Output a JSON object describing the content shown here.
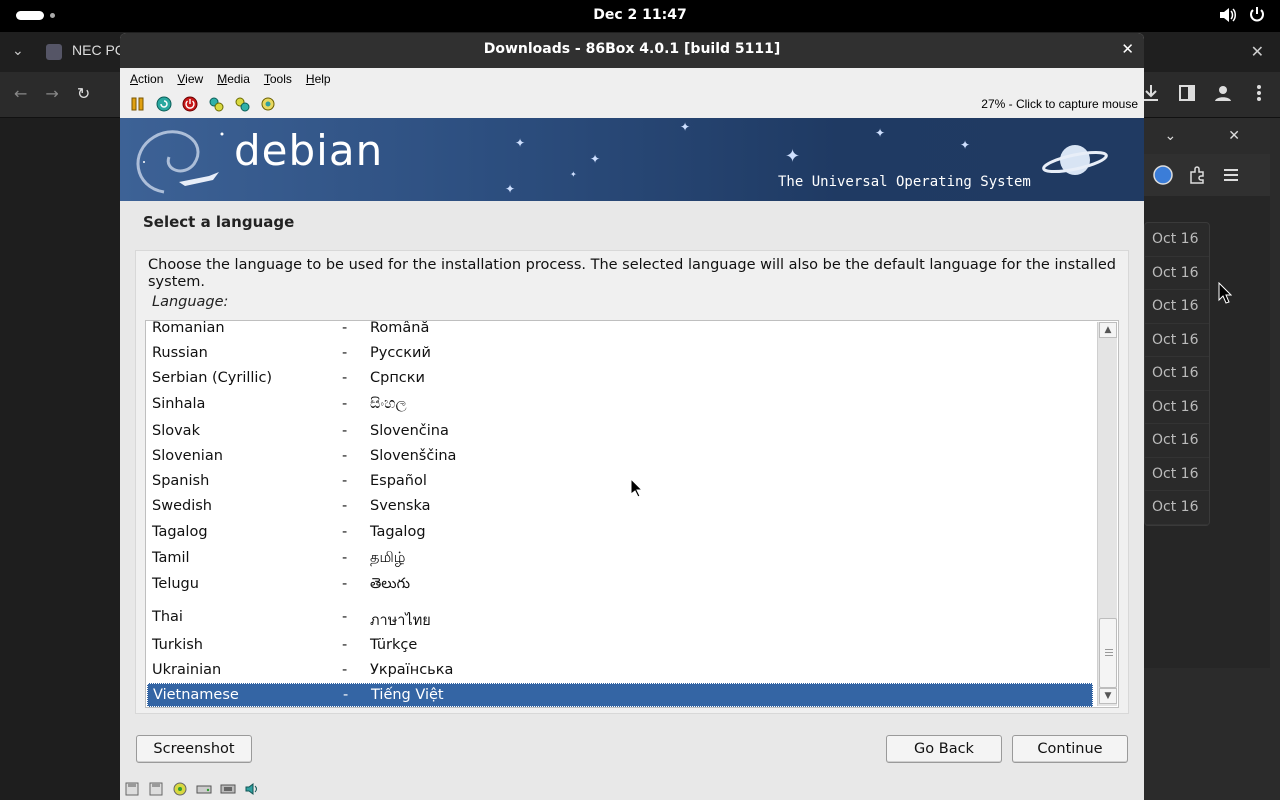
{
  "topbar": {
    "clock": "Dec 2  11:47",
    "icons": [
      "activities-pill",
      "volume-icon",
      "power-icon"
    ]
  },
  "browser": {
    "tab_title": "NEC PC",
    "download_dates": [
      "Oct 16",
      "Oct 16",
      "Oct 16",
      "Oct 16",
      "Oct 16",
      "Oct 16",
      "Oct 16",
      "Oct 16",
      "Oct 16"
    ],
    "icons": [
      "chevron-down-icon",
      "back-icon",
      "forward-icon",
      "reload-icon",
      "download-icon",
      "sidebar-icon",
      "account-icon",
      "menu-icon",
      "extensions-icon",
      "close-icon"
    ]
  },
  "vm": {
    "title": "Downloads - 86Box 4.0.1 [build 5111]",
    "menu": [
      "Action",
      "View",
      "Media",
      "Tools",
      "Help"
    ],
    "capture_text": "27% - Click to capture mouse",
    "toolbar_icons": [
      "pause-icon",
      "reset-icon",
      "power-icon",
      "ctrl-alt-del-icon",
      "ctrl-alt-esc-icon",
      "settings-icon"
    ],
    "status_icons": [
      "floppy-icon",
      "floppy-icon",
      "cdrom-icon",
      "hdd-icon",
      "network-icon",
      "sound-icon"
    ]
  },
  "installer": {
    "logo_text": "debian",
    "tagline": "The Universal Operating System",
    "heading": "Select a language",
    "description": "Choose the language to be used for the installation process. The selected language will also be the default language for the installed system.",
    "list_label": "Language:",
    "languages": [
      {
        "name": "Romanian",
        "sep": "-",
        "native": "Română"
      },
      {
        "name": "Russian",
        "sep": "-",
        "native": "Русский"
      },
      {
        "name": "Serbian (Cyrillic)",
        "sep": "-",
        "native": "Српски"
      },
      {
        "name": "Sinhala",
        "sep": "-",
        "native": "සිංහල"
      },
      {
        "name": "Slovak",
        "sep": "-",
        "native": "Slovenčina"
      },
      {
        "name": "Slovenian",
        "sep": "-",
        "native": "Slovenščina"
      },
      {
        "name": "Spanish",
        "sep": "-",
        "native": "Español"
      },
      {
        "name": "Swedish",
        "sep": "-",
        "native": "Svenska"
      },
      {
        "name": "Tagalog",
        "sep": "-",
        "native": "Tagalog"
      },
      {
        "name": "Tamil",
        "sep": "-",
        "native": "தமிழ்"
      },
      {
        "name": "Telugu",
        "sep": "-",
        "native": "తెలుగు"
      },
      {
        "name": "Thai",
        "sep": "-",
        "native": "ภาษาไทย"
      },
      {
        "name": "Turkish",
        "sep": "-",
        "native": "Türkçe"
      },
      {
        "name": "Ukrainian",
        "sep": "-",
        "native": "Українська"
      },
      {
        "name": "Vietnamese",
        "sep": "-",
        "native": "Tiếng Việt"
      }
    ],
    "selected": "Vietnamese",
    "buttons": {
      "screenshot": "Screenshot",
      "go_back": "Go Back",
      "continue": "Continue"
    },
    "colors": {
      "selection": "#3465a4",
      "banner": "#2d4f80"
    }
  }
}
